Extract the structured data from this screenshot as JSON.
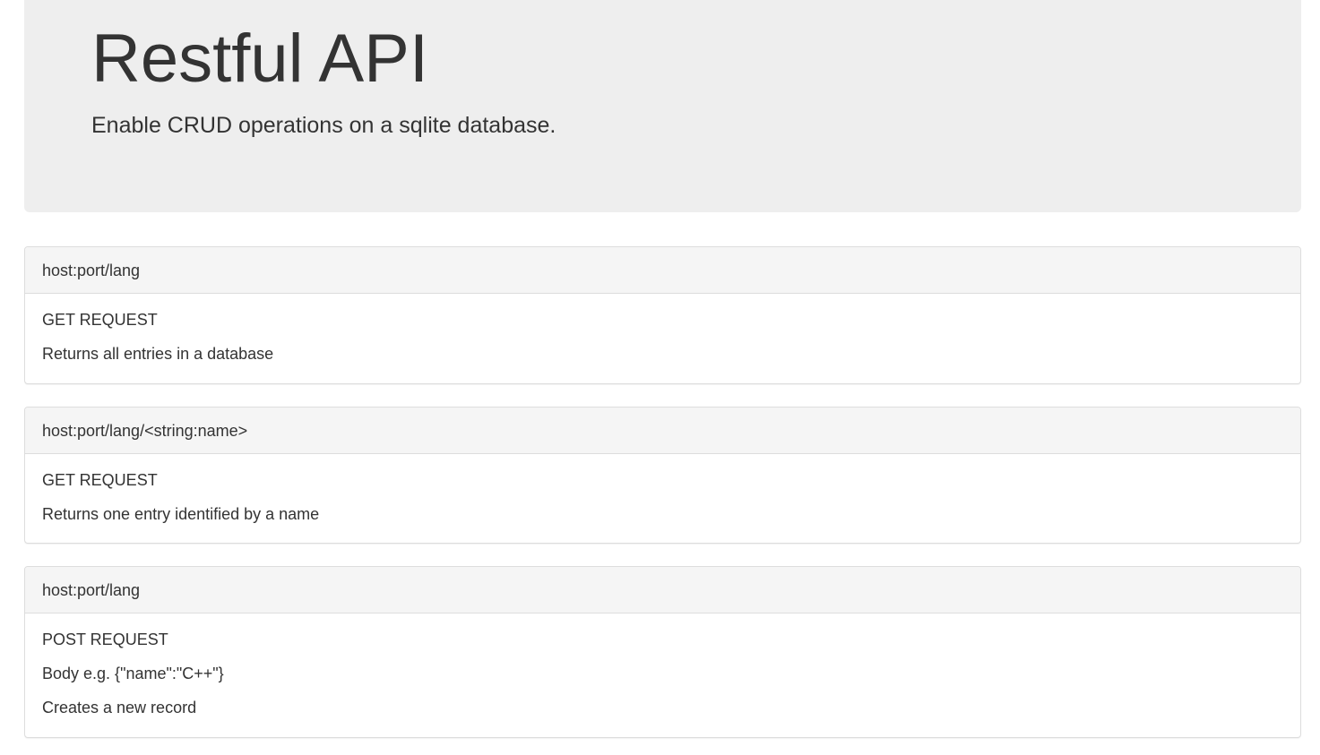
{
  "jumbotron": {
    "title": "Restful API",
    "lead": "Enable CRUD operations on a sqlite database."
  },
  "endpoints": [
    {
      "route": "host:port/lang",
      "lines": [
        "GET REQUEST",
        "Returns all entries in a database"
      ]
    },
    {
      "route": "host:port/lang/<string:name>",
      "lines": [
        "GET REQUEST",
        "Returns one entry identified by a name"
      ]
    },
    {
      "route": "host:port/lang",
      "lines": [
        "POST REQUEST",
        "Body e.g. {\"name\":\"C++\"}",
        "Creates a new record"
      ]
    }
  ],
  "colors": {
    "jumbotron_bg": "#eeeeee",
    "panel_heading_bg": "#f5f5f5",
    "border": "#dddddd",
    "text": "#333333"
  }
}
